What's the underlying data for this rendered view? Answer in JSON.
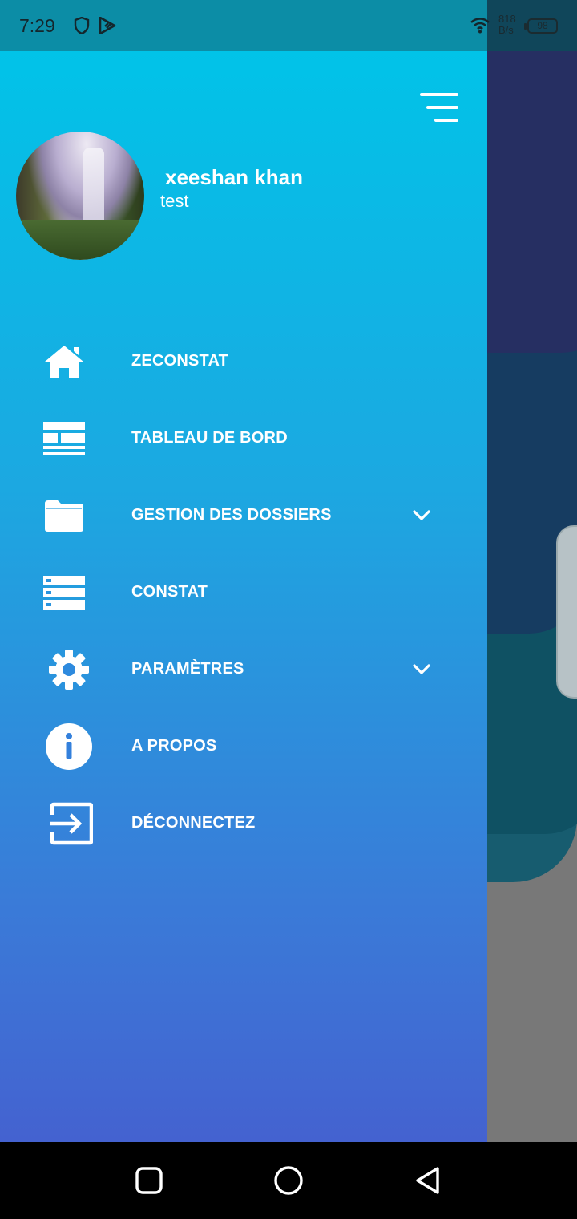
{
  "status_bar": {
    "time": "7:29",
    "net_speed_value": "818",
    "net_speed_unit": "B/s",
    "battery": "98",
    "icons": [
      "shield-icon",
      "play-store-icon",
      "wifi-icon",
      "battery-icon"
    ]
  },
  "drawer": {
    "user": {
      "name": "xeeshan khan",
      "subtitle": "test"
    },
    "menu": [
      {
        "label": "ZECONSTAT",
        "icon": "home-icon",
        "expandable": false
      },
      {
        "label": "TABLEAU DE BORD",
        "icon": "dashboard-icon",
        "expandable": false
      },
      {
        "label": "GESTION DES DOSSIERS",
        "icon": "folder-icon",
        "expandable": true
      },
      {
        "label": "CONSTAT",
        "icon": "list-icon",
        "expandable": false
      },
      {
        "label": "PARAMÈTRES",
        "icon": "gear-icon",
        "expandable": true
      },
      {
        "label": "A PROPOS",
        "icon": "info-icon",
        "expandable": false
      },
      {
        "label": "DÉCONNECTEZ",
        "icon": "logout-icon",
        "expandable": false
      }
    ]
  },
  "colors": {
    "drawer_top": "#01c3e8",
    "drawer_bottom": "#4462d0",
    "status_bar": "#0c8da6",
    "nav_bar": "#000000"
  },
  "nav_bar": {
    "buttons": [
      "recents-button",
      "home-button",
      "back-button"
    ]
  }
}
